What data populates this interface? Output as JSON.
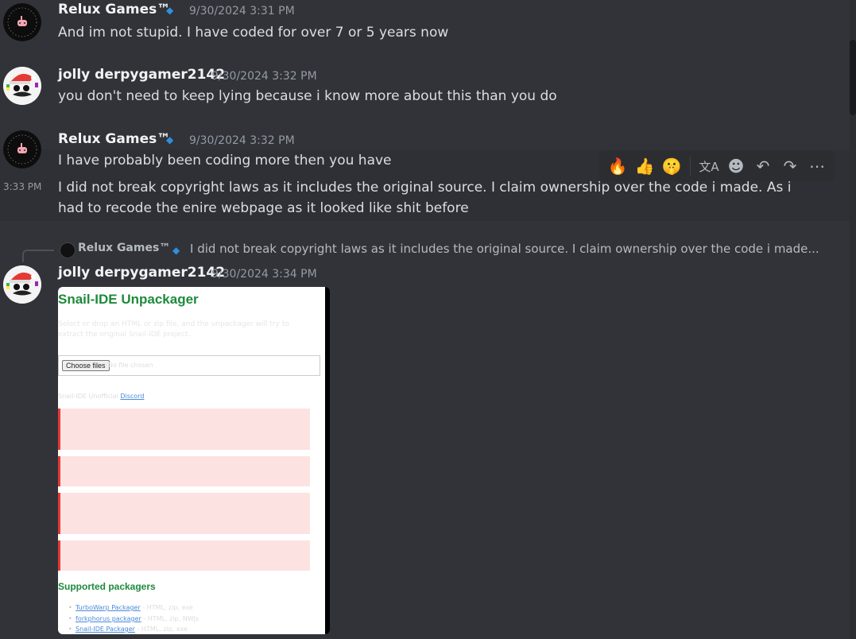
{
  "messages": [
    {
      "username": "Relux Games™",
      "badge": "◆",
      "timestamp": "9/30/2024 3:31 PM",
      "text": "And im not stupid. I have coded for over 7 or 5 years now"
    },
    {
      "username": "jolly derpygamer2142",
      "timestamp": "9/30/2024 3:32 PM",
      "text": "you don't need to keep lying because i know more about this than you do"
    },
    {
      "username": "Relux Games™",
      "badge": "◆",
      "timestamp": "9/30/2024 3:32 PM",
      "text": "I have probably been coding more then you have"
    }
  ],
  "followup": {
    "side_time": "3:33 PM",
    "line1": "I did not break copyright laws as it includes the original source. I claim ownership over the code i made. As i",
    "line2": "had to recode the enire webpage as it looked like shit before"
  },
  "toolbar": {
    "icons": [
      "fire-emoji",
      "thumbs-up-emoji",
      "shushing-face-emoji",
      "translate-icon",
      "add-reaction-icon",
      "reply-icon",
      "forward-icon",
      "more-icon"
    ],
    "glyphs": [
      "🔥",
      "👍",
      "🤫",
      "文A",
      "☻",
      "↶",
      "↷",
      "⋯"
    ]
  },
  "reply": {
    "username": "Relux Games™",
    "badge": "◆",
    "text": "I did not break copyright laws as it includes the original source. I claim ownership over the code i made..."
  },
  "last_message": {
    "username": "jolly derpygamer2142",
    "timestamp": "9/30/2024 3:34 PM"
  },
  "embed": {
    "title": "Snail-IDE Unpackager",
    "description": "Select or drop an HTML or zip file, and the unpackager will try to extract the original Snail-IDE project.",
    "file_button": "Choose files",
    "file_status": "No file chosen",
    "footer_prefix": "Snail-IDE Unofficial",
    "footer_link": "Discord",
    "subheading": "Supported packagers",
    "packagers": [
      {
        "name": "TurboWarp Packager",
        "formats": "- HTML, zip, exe"
      },
      {
        "name": "forkphorus packager",
        "formats": "- HTML, zip, NWJs"
      },
      {
        "name": "Snail-IDE Packager",
        "formats": "- HTML, zip, exe"
      }
    ]
  }
}
